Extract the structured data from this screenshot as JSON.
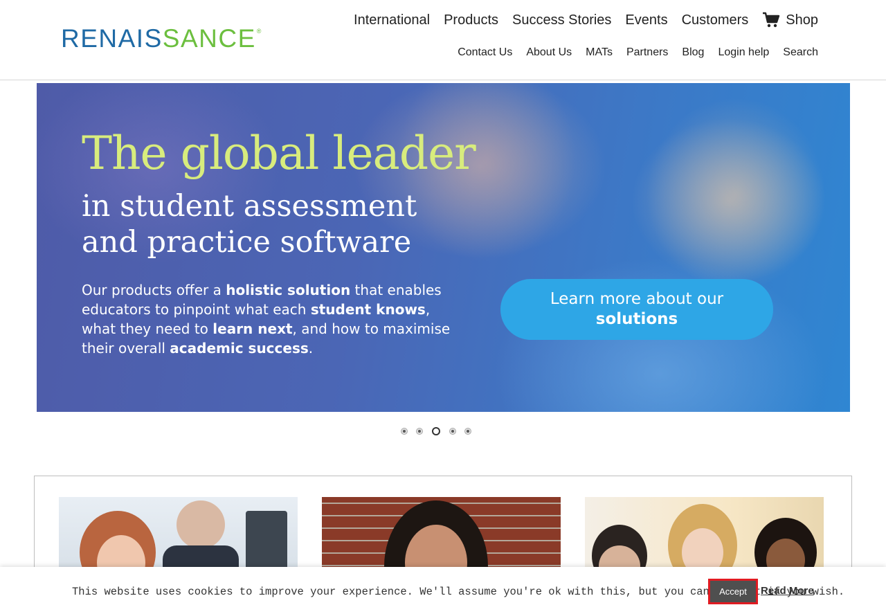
{
  "header": {
    "logo": {
      "text_part1": "RENAIS",
      "text_part2": "SANCE",
      "reg": "®"
    },
    "primary_nav": [
      "International",
      "Products",
      "Success Stories",
      "Events",
      "Customers"
    ],
    "shop_label": "Shop",
    "secondary_nav": [
      "Contact Us",
      "About Us",
      "MATs",
      "Partners",
      "Blog",
      "Login help",
      "Search"
    ]
  },
  "hero": {
    "title": "The global leader",
    "subtitle": "in student assessment and practice software",
    "body": {
      "t1": "Our products offer a ",
      "b1": "holistic solution",
      "t2": " that enables educators to pinpoint what each ",
      "b2": "student knows",
      "t3": ", what they need to ",
      "b3": "learn next",
      "t4": ", and how to maximise their overall ",
      "b4": "academic success",
      "t5": "."
    },
    "cta_line1": "Learn more about our",
    "cta_line2": "solutions"
  },
  "slider": {
    "slide_count": 5,
    "active_index": 2
  },
  "cookie": {
    "message": "This website uses cookies to improve your experience. We'll assume you're ok with this, but you can opt-out if you wish.",
    "accept_label": "Accept",
    "read_more_label": "Read More"
  },
  "colors": {
    "brand_blue": "#1f6aa5",
    "brand_green": "#6cbf3f",
    "hero_title": "#d8ec7d",
    "cta": "#2ea6e6",
    "accept_outline": "#e01b22"
  },
  "icons": {
    "cart": "shopping-cart-icon"
  }
}
